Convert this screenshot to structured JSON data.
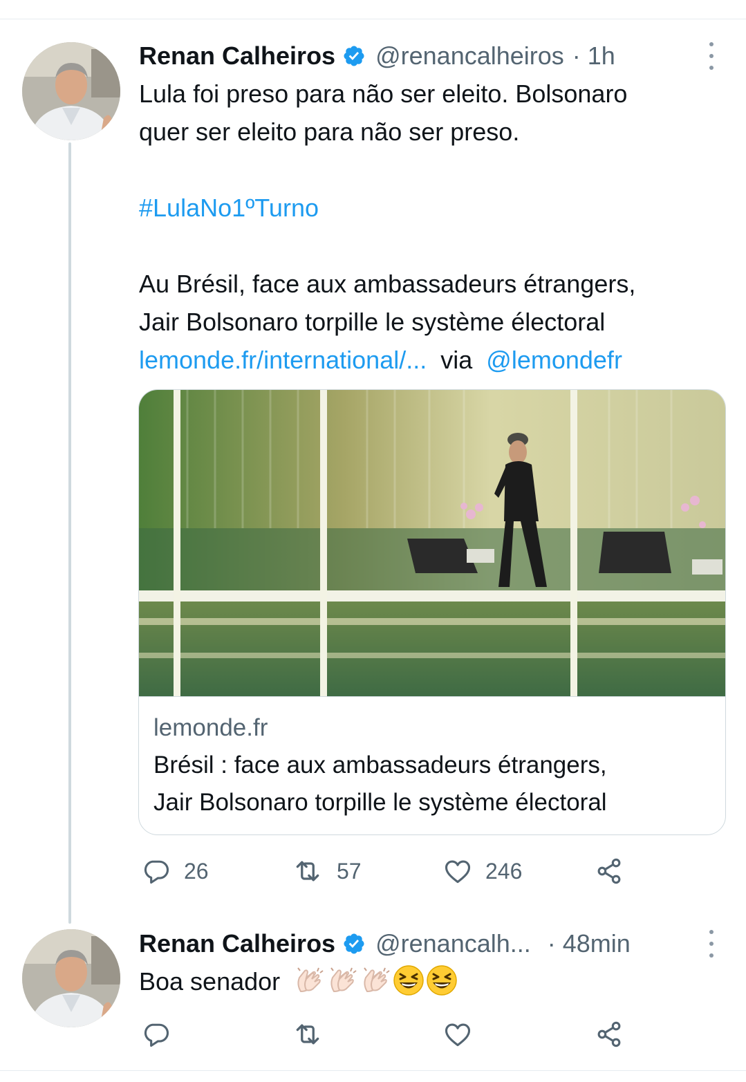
{
  "tweet1": {
    "name": "Renan Calheiros",
    "handle": "@renancalheiros",
    "time": "· 1h",
    "text_line1": "Lula foi preso para não ser eleito. Bolsonaro",
    "text_line2": "quer ser eleito para não ser preso.",
    "hashtag": "#LulaNo1ºTurno",
    "quote_line1": "Au Brésil, face aux ambassadeurs étrangers,",
    "quote_line2": "Jair Bolsonaro torpille le système électoral",
    "url": "lemonde.fr/international/...",
    "via": "via",
    "via_handle": "@lemondefr",
    "card": {
      "domain": "lemonde.fr",
      "title_line1": "Brésil : face aux ambassadeurs étrangers,",
      "title_line2": "Jair Bolsonaro torpille le système électoral"
    },
    "actions": {
      "replies": "26",
      "retweets": "57",
      "likes": "246"
    }
  },
  "tweet2": {
    "name": "Renan Calheiros",
    "handle": "@renancalh...",
    "time": "· 48min",
    "text": "Boa senador",
    "emojis": [
      "clapping-hands",
      "clapping-hands",
      "clapping-hands",
      "grinning-squinting-face",
      "grinning-squinting-face"
    ]
  },
  "colors": {
    "link": "#1d9bf0",
    "secondary": "#536471",
    "verified": "#1d9bf0",
    "thread_line": "#cfd9de"
  }
}
